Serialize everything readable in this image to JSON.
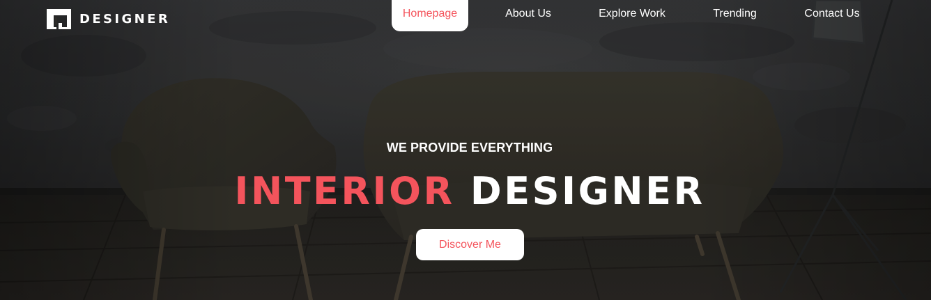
{
  "brand": {
    "name": "DESIGNER",
    "logo_icon": "bookmark-window-logo-icon"
  },
  "nav": {
    "items": [
      {
        "label": "Homepage",
        "active": true
      },
      {
        "label": "About Us",
        "active": false
      },
      {
        "label": "Explore Work",
        "active": false
      },
      {
        "label": "Trending",
        "active": false
      },
      {
        "label": "Contact Us",
        "active": false
      }
    ]
  },
  "hero": {
    "tagline": "WE PROVIDE EVERYTHING",
    "headline_accent": "INTERIOR",
    "headline_rest": "DESIGNER",
    "cta_label": "Discover Me"
  },
  "colors": {
    "accent": "#f4545c",
    "text_light": "#ffffff",
    "overlay_dark": "#2c2b29"
  }
}
